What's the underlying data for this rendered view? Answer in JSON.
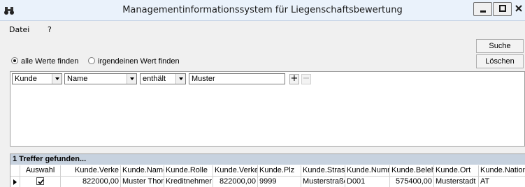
{
  "window": {
    "title": "Managementinformationssystem für Liegenschaftsbewertung"
  },
  "menu": {
    "items": [
      {
        "label": "Datei"
      },
      {
        "label": "?"
      }
    ]
  },
  "actions": {
    "search_label": "Suche",
    "clear_label": "Löschen"
  },
  "search_mode": {
    "options": [
      {
        "label": "alle Werte finden",
        "selected": true
      },
      {
        "label": "irgendeinen Wert finden",
        "selected": false
      }
    ]
  },
  "filter": {
    "table": "Kunde",
    "field": "Name",
    "operator": "enthält",
    "value": "Muster",
    "add_label": "+",
    "remove_label": "−"
  },
  "results": {
    "summary": "1 Treffer gefunden...",
    "columns": [
      "Auswahl",
      "Kunde.Verke",
      "Kunde.Name",
      "Kunde.Rolle",
      "Kunde.Verke",
      "Kunde.Plz",
      "Kunde.Strass",
      "Kunde.Numm",
      "Kunde.Belehr",
      "Kunde.Ort",
      "Kunde.Nation"
    ],
    "rows": [
      {
        "selected": true,
        "cells": [
          "",
          "822000,00",
          "Muster Thom",
          "Kreditnehmer",
          "822000,00",
          "9999",
          "Musterstraße",
          "D001",
          "575400,00",
          "Musterstadt",
          "AT"
        ]
      }
    ]
  }
}
